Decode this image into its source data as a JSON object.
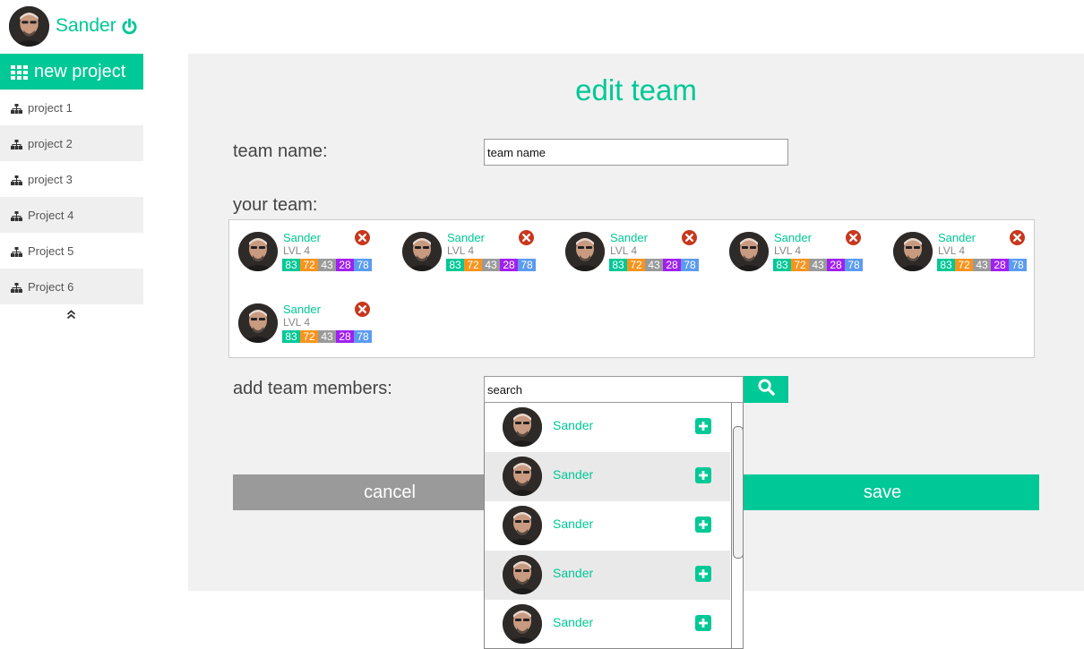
{
  "user": {
    "name": "Sander"
  },
  "sidebar": {
    "new_project_label": "new project",
    "items": [
      {
        "label": "project 1"
      },
      {
        "label": "project 2"
      },
      {
        "label": "project 3"
      },
      {
        "label": "Project 4"
      },
      {
        "label": "Project 5"
      },
      {
        "label": "Project 6"
      }
    ]
  },
  "page": {
    "title": "edit team",
    "team_name_label": "team name:",
    "team_name_value": "team name",
    "your_team_label": "your team:",
    "add_members_label": "add team members:",
    "search_value": "search"
  },
  "team": {
    "members": [
      {
        "name": "Sander",
        "level": "LVL 4",
        "stats": [
          "83",
          "72",
          "43",
          "28",
          "78"
        ]
      },
      {
        "name": "Sander",
        "level": "LVL 4",
        "stats": [
          "83",
          "72",
          "43",
          "28",
          "78"
        ]
      },
      {
        "name": "Sander",
        "level": "LVL 4",
        "stats": [
          "83",
          "72",
          "43",
          "28",
          "78"
        ]
      },
      {
        "name": "Sander",
        "level": "LVL 4",
        "stats": [
          "83",
          "72",
          "43",
          "28",
          "78"
        ]
      },
      {
        "name": "Sander",
        "level": "LVL 4",
        "stats": [
          "83",
          "72",
          "43",
          "28",
          "78"
        ]
      },
      {
        "name": "Sander",
        "level": "LVL 4",
        "stats": [
          "83",
          "72",
          "43",
          "28",
          "78"
        ]
      }
    ],
    "stat_colors": [
      "#00c896",
      "#f7941d",
      "#9a9a9a",
      "#a020f0",
      "#5b9bf0"
    ]
  },
  "search_results": [
    {
      "name": "Sander"
    },
    {
      "name": "Sander"
    },
    {
      "name": "Sander"
    },
    {
      "name": "Sander"
    },
    {
      "name": "Sander"
    }
  ],
  "buttons": {
    "cancel": "cancel",
    "save": "save"
  },
  "colors": {
    "accent": "#00c896",
    "remove": "#c8381e",
    "cancel": "#9a9a9a",
    "panel": "#f1f1f1"
  }
}
